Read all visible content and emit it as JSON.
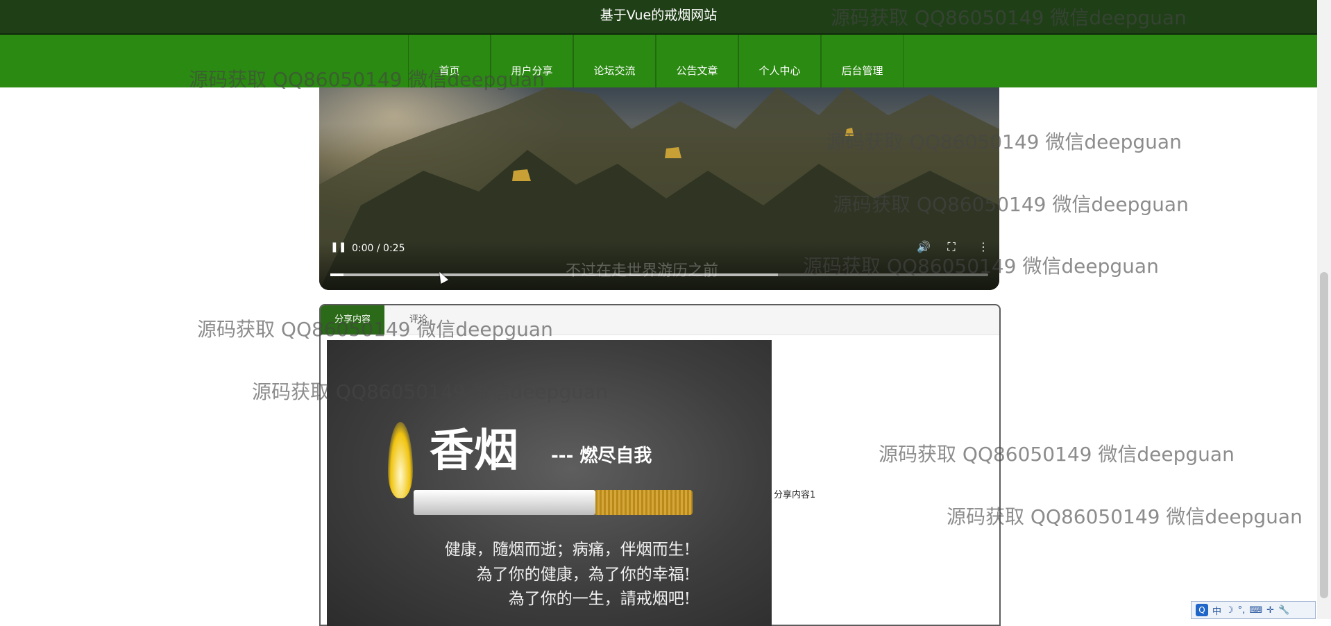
{
  "site": {
    "title": "基于Vue的戒烟网站"
  },
  "nav": {
    "items": [
      "首页",
      "用户分享",
      "论坛交流",
      "公告文章",
      "个人中心",
      "后台管理"
    ]
  },
  "video": {
    "time": "0:00 / 0:25",
    "caption": "不过在走世界游历之前",
    "progress_played": 0.02,
    "progress_buffered": 0.68,
    "icons": {
      "play_pause": "pause-icon",
      "volume": "volume-icon",
      "fullscreen": "fullscreen-icon",
      "more": "more-vert-icon"
    }
  },
  "tabs": {
    "active": "分享内容",
    "other": "评论"
  },
  "poster": {
    "headline": "香烟",
    "subline": "--- 燃尽自我",
    "lines": [
      "健康，隨烟而逝；病痛，伴烟而生!",
      "為了你的健康，為了你的幸福!",
      "為了你的一生，請戒烟吧!"
    ]
  },
  "share_label": "分享内容1",
  "watermark": "源码获取 QQ86050149 微信deepguan",
  "ime": {
    "logo": "Q",
    "items": [
      "中",
      "☽",
      "°,",
      "⌨",
      "✛",
      "🔧"
    ]
  },
  "colors": {
    "nav_green": "#2b8a12",
    "title_dark": "#1f3f17",
    "tab_active": "#2b6a18"
  }
}
